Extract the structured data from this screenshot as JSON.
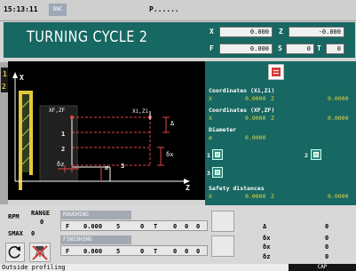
{
  "topbar": {
    "time": "15:13:11",
    "mode_badge": "DNC",
    "program": "P......"
  },
  "header": {
    "title": "TURNING CYCLE 2",
    "x_label": "X",
    "x_value": "0.000",
    "z_label": "Z",
    "z_value": "-0.000",
    "f_label": "F",
    "f_value": "0.000",
    "s_label": "S",
    "s_value": "0",
    "t_label": "T",
    "t_value": "0"
  },
  "side": {
    "marks": [
      "1",
      "2"
    ]
  },
  "drawing": {
    "x_axis": "X",
    "z_axis": "Z",
    "xf_zf": "XF,ZF",
    "xi_zi": "Xi,Zi",
    "delta": "Δ",
    "delta_x": "δx",
    "delta_z": "δz",
    "diameter": "ø",
    "n1": "1",
    "n2": "2",
    "n3": "3"
  },
  "params": {
    "coords_i": {
      "label": "Coordinates (Xi,Zi)",
      "x": "X",
      "x_val": "0.0000",
      "z": "Z",
      "z_val": "0.0000"
    },
    "coords_f": {
      "label": "Coordinates (XF,ZF)",
      "x": "X",
      "x_val": "0.0000",
      "z": "Z",
      "z_val": "0.0000"
    },
    "diameter": {
      "label": "Diameter",
      "sym": "ø",
      "val": "0.0000"
    },
    "opt1": "1",
    "opt2": "2",
    "opt3": "3",
    "safety": {
      "label": "Safety distances",
      "x": "X",
      "x_val": "0.0000",
      "z": "Z",
      "z_val": "0.0000"
    }
  },
  "bottom": {
    "rpm": "RPM",
    "range": "RANGE",
    "range_val": "0",
    "smax": "SMAX",
    "smax_val": "0",
    "roughing": {
      "title": "ROUGHING",
      "f": "F",
      "f_val": "0.000",
      "s_val": "5",
      "z1": "0",
      "t": "T",
      "z2": "0",
      "z3": "0",
      "z4": "0",
      "p1": "Δ",
      "v1": "0",
      "p2": "δx",
      "v2": "0"
    },
    "finishing": {
      "title": "FINISHING",
      "f": "F",
      "f_val": "0.000",
      "s_val": "5",
      "z1": "0",
      "t": "T",
      "z2": "0",
      "z3": "0",
      "z4": "0",
      "p1": "δx",
      "v1": "0",
      "p2": "δz",
      "v2": "0"
    }
  },
  "status": {
    "text": "Outside profiling",
    "cap": "CAP"
  }
}
